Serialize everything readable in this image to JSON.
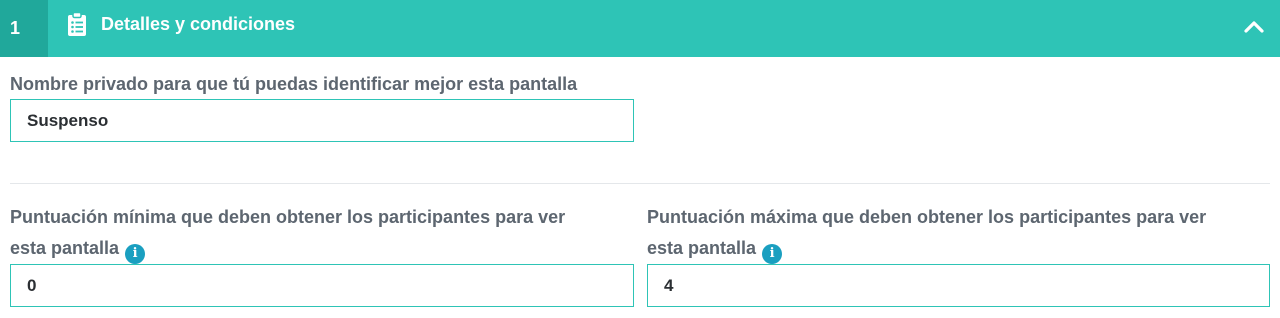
{
  "header": {
    "step": "1",
    "title": "Detalles y condiciones",
    "icon": "clipboard-list-icon",
    "toggle_icon": "chevron-up-icon",
    "colors": {
      "bar": "#2ec4b6",
      "step_bg": "#20a89b"
    }
  },
  "private_name": {
    "label": "Nombre privado para que tú puedas identificar mejor esta pantalla",
    "value": "Suspenso"
  },
  "min_score": {
    "label_line1": "Puntuación mínima que deben obtener los participantes para ver",
    "label_line2": "esta pantalla",
    "value": "0",
    "info_icon": "info-icon"
  },
  "max_score": {
    "label_line1": "Puntuación máxima que deben obtener los participantes para ver",
    "label_line2": "esta pantalla",
    "value": "4",
    "info_icon": "info-icon"
  }
}
